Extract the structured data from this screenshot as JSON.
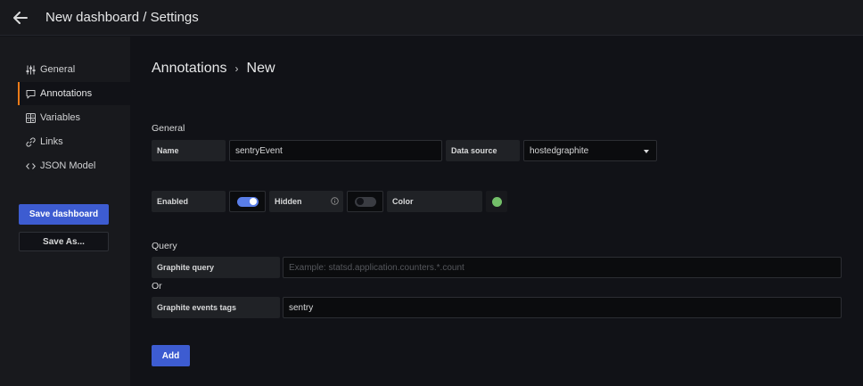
{
  "header": {
    "title": "New dashboard / Settings",
    "back_icon": "arrow-left-icon"
  },
  "sidebar": {
    "items": [
      {
        "label": "General",
        "icon": "sliders-icon",
        "active": false
      },
      {
        "label": "Annotations",
        "icon": "comment-icon",
        "active": true
      },
      {
        "label": "Variables",
        "icon": "calculator-icon",
        "active": false
      },
      {
        "label": "Links",
        "icon": "link-icon",
        "active": false
      },
      {
        "label": "JSON Model",
        "icon": "code-icon",
        "active": false
      }
    ],
    "save_label": "Save dashboard",
    "save_as_label": "Save As..."
  },
  "main": {
    "breadcrumb": {
      "parent": "Annotations",
      "separator": "›",
      "current": "New"
    },
    "general": {
      "title": "General",
      "name_label": "Name",
      "name_value": "sentryEvent",
      "datasource_label": "Data source",
      "datasource_value": "hostedgraphite",
      "enabled_label": "Enabled",
      "enabled": true,
      "hidden_label": "Hidden",
      "hidden": false,
      "color_label": "Color",
      "color_value": "#73bf69"
    },
    "query": {
      "title": "Query",
      "graphite_query_label": "Graphite query",
      "graphite_query_value": "",
      "graphite_query_placeholder": "Example: statsd.application.counters.*.count",
      "or_label": "Or",
      "tags_label": "Graphite events tags",
      "tags_value": "sentry"
    },
    "add_label": "Add"
  },
  "colors": {
    "accent": "#3d5cd1",
    "active_border": "#eb7b18",
    "toggle_on": "#5a7ee8"
  }
}
